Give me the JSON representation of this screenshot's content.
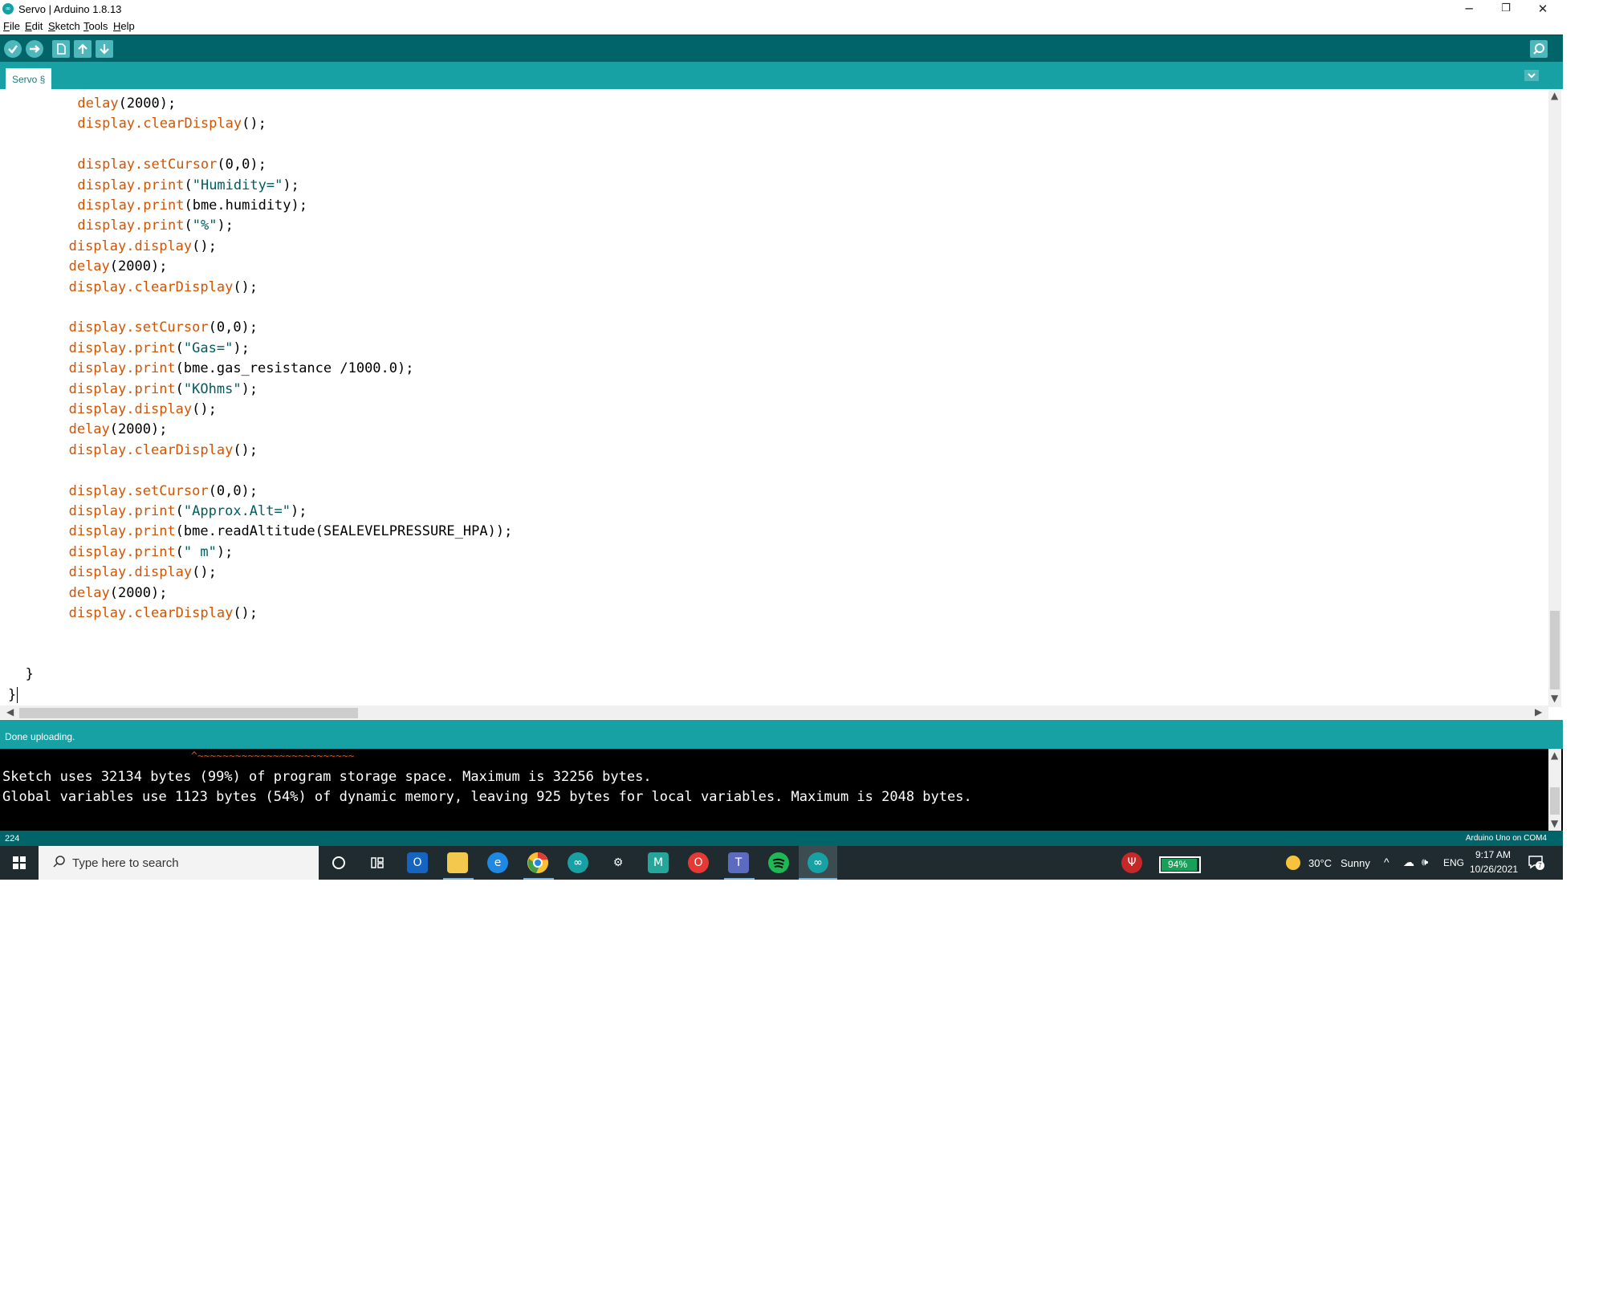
{
  "window": {
    "title": "Servo | Arduino 1.8.13",
    "minimize_icon": "─",
    "restore_icon": "❐",
    "close_icon": "✕"
  },
  "menu": [
    "File",
    "Edit",
    "Sketch",
    "Tools",
    "Help"
  ],
  "tabs": [
    {
      "label": "Servo §"
    }
  ],
  "editor": {
    "lines": [
      {
        "indent": 8,
        "tokens": [
          {
            "t": "delay",
            "k": "fn"
          },
          {
            "t": "(2000);",
            "k": "p"
          }
        ]
      },
      {
        "indent": 8,
        "tokens": [
          {
            "t": "display.",
            "k": "fn"
          },
          {
            "t": "clearDisplay",
            "k": "fn"
          },
          {
            "t": "();",
            "k": "p"
          }
        ]
      },
      {
        "indent": 0,
        "tokens": []
      },
      {
        "indent": 8,
        "tokens": [
          {
            "t": "display.",
            "k": "fn"
          },
          {
            "t": "setCursor",
            "k": "fn"
          },
          {
            "t": "(0,0);",
            "k": "p"
          }
        ]
      },
      {
        "indent": 8,
        "tokens": [
          {
            "t": "display.",
            "k": "fn"
          },
          {
            "t": "print",
            "k": "fn"
          },
          {
            "t": "(",
            "k": "p"
          },
          {
            "t": "\"Humidity=\"",
            "k": "str"
          },
          {
            "t": ");",
            "k": "p"
          }
        ]
      },
      {
        "indent": 8,
        "tokens": [
          {
            "t": "display.",
            "k": "fn"
          },
          {
            "t": "print",
            "k": "fn"
          },
          {
            "t": "(bme.humidity);",
            "k": "p"
          }
        ]
      },
      {
        "indent": 8,
        "tokens": [
          {
            "t": "display.",
            "k": "fn"
          },
          {
            "t": "print",
            "k": "fn"
          },
          {
            "t": "(",
            "k": "p"
          },
          {
            "t": "\"%\"",
            "k": "str"
          },
          {
            "t": ");",
            "k": "p"
          }
        ]
      },
      {
        "indent": 7,
        "tokens": [
          {
            "t": "display.",
            "k": "fn"
          },
          {
            "t": "display",
            "k": "fn"
          },
          {
            "t": "();",
            "k": "p"
          }
        ]
      },
      {
        "indent": 7,
        "tokens": [
          {
            "t": "delay",
            "k": "fn"
          },
          {
            "t": "(2000);",
            "k": "p"
          }
        ]
      },
      {
        "indent": 7,
        "tokens": [
          {
            "t": "display.",
            "k": "fn"
          },
          {
            "t": "clearDisplay",
            "k": "fn"
          },
          {
            "t": "();",
            "k": "p"
          }
        ]
      },
      {
        "indent": 0,
        "tokens": []
      },
      {
        "indent": 7,
        "tokens": [
          {
            "t": "display.",
            "k": "fn"
          },
          {
            "t": "setCursor",
            "k": "fn"
          },
          {
            "t": "(0,0);",
            "k": "p"
          }
        ]
      },
      {
        "indent": 7,
        "tokens": [
          {
            "t": "display.",
            "k": "fn"
          },
          {
            "t": "print",
            "k": "fn"
          },
          {
            "t": "(",
            "k": "p"
          },
          {
            "t": "\"Gas=\"",
            "k": "str"
          },
          {
            "t": ");",
            "k": "p"
          }
        ]
      },
      {
        "indent": 7,
        "tokens": [
          {
            "t": "display.",
            "k": "fn"
          },
          {
            "t": "print",
            "k": "fn"
          },
          {
            "t": "(bme.gas_resistance /1000.0);",
            "k": "p"
          }
        ]
      },
      {
        "indent": 7,
        "tokens": [
          {
            "t": "display.",
            "k": "fn"
          },
          {
            "t": "print",
            "k": "fn"
          },
          {
            "t": "(",
            "k": "p"
          },
          {
            "t": "\"KOhms\"",
            "k": "str"
          },
          {
            "t": ");",
            "k": "p"
          }
        ]
      },
      {
        "indent": 7,
        "tokens": [
          {
            "t": "display.",
            "k": "fn"
          },
          {
            "t": "display",
            "k": "fn"
          },
          {
            "t": "();",
            "k": "p"
          }
        ]
      },
      {
        "indent": 7,
        "tokens": [
          {
            "t": "delay",
            "k": "fn"
          },
          {
            "t": "(2000);",
            "k": "p"
          }
        ]
      },
      {
        "indent": 7,
        "tokens": [
          {
            "t": "display.",
            "k": "fn"
          },
          {
            "t": "clearDisplay",
            "k": "fn"
          },
          {
            "t": "();",
            "k": "p"
          }
        ]
      },
      {
        "indent": 0,
        "tokens": []
      },
      {
        "indent": 7,
        "tokens": [
          {
            "t": "display.",
            "k": "fn"
          },
          {
            "t": "setCursor",
            "k": "fn"
          },
          {
            "t": "(0,0);",
            "k": "p"
          }
        ]
      },
      {
        "indent": 7,
        "tokens": [
          {
            "t": "display.",
            "k": "fn"
          },
          {
            "t": "print",
            "k": "fn"
          },
          {
            "t": "(",
            "k": "p"
          },
          {
            "t": "\"Approx.Alt=\"",
            "k": "str"
          },
          {
            "t": ");",
            "k": "p"
          }
        ]
      },
      {
        "indent": 7,
        "tokens": [
          {
            "t": "display.",
            "k": "fn"
          },
          {
            "t": "print",
            "k": "fn"
          },
          {
            "t": "(bme.readAltitude(SEALEVELPRESSURE_HPA));",
            "k": "p"
          }
        ]
      },
      {
        "indent": 7,
        "tokens": [
          {
            "t": "display.",
            "k": "fn"
          },
          {
            "t": "print",
            "k": "fn"
          },
          {
            "t": "(",
            "k": "p"
          },
          {
            "t": "\" m\"",
            "k": "str"
          },
          {
            "t": ");",
            "k": "p"
          }
        ]
      },
      {
        "indent": 7,
        "tokens": [
          {
            "t": "display.",
            "k": "fn"
          },
          {
            "t": "display",
            "k": "fn"
          },
          {
            "t": "();",
            "k": "p"
          }
        ]
      },
      {
        "indent": 7,
        "tokens": [
          {
            "t": "delay",
            "k": "fn"
          },
          {
            "t": "(2000);",
            "k": "p"
          }
        ]
      },
      {
        "indent": 7,
        "tokens": [
          {
            "t": "display.",
            "k": "fn"
          },
          {
            "t": "clearDisplay",
            "k": "fn"
          },
          {
            "t": "();",
            "k": "p"
          }
        ]
      },
      {
        "indent": 0,
        "tokens": []
      },
      {
        "indent": 0,
        "tokens": []
      },
      {
        "indent": 2,
        "tokens": [
          {
            "t": "}",
            "k": "p"
          }
        ]
      },
      {
        "indent": 0,
        "tokens": [
          {
            "t": "}",
            "k": "p"
          }
        ]
      }
    ]
  },
  "status": {
    "message": "Done uploading."
  },
  "console": {
    "squiggle": "^~~~~~~~~~~~~~~~~~~~~~~~~~",
    "lines": [
      "Sketch uses 32134 bytes (99%) of program storage space. Maximum is 32256 bytes.",
      "Global variables use 1123 bytes (54%) of dynamic memory, leaving 925 bytes for local variables. Maximum is 2048 bytes."
    ]
  },
  "bottombar": {
    "line_number": "224",
    "board": "Arduino Uno on COM4"
  },
  "taskbar": {
    "search_placeholder": "Type here to search",
    "battery": "94%",
    "weather_temp": "30°C",
    "weather_desc": "Sunny",
    "language": "ENG",
    "time": "9:17 AM",
    "date": "10/26/2021",
    "notification_count": "7",
    "apps": [
      "cortana-circle",
      "task-view",
      "outlook",
      "file-explorer",
      "edge",
      "chrome",
      "arduino",
      "settings",
      "app-m",
      "opera",
      "teams",
      "spotify",
      "arduino-active"
    ]
  },
  "colors": {
    "accent": "#17a1a5",
    "toolbar": "#006468",
    "function": "#d35400",
    "string": "#005c5f"
  }
}
